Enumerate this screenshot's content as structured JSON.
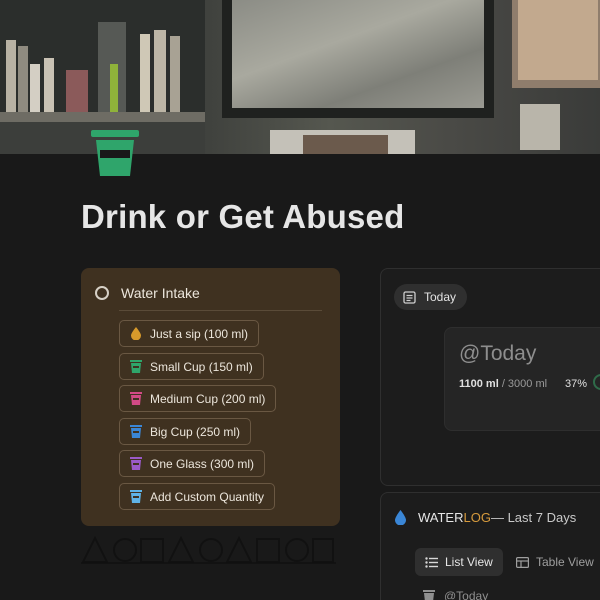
{
  "page": {
    "title": "Drink or Get Abused",
    "icon": "green-cup-icon"
  },
  "intake": {
    "title": "Water Intake",
    "buttons": [
      {
        "label": "Just a sip (100 ml)",
        "icon": "orange-drop-icon",
        "color": "#d89a2b"
      },
      {
        "label": "Small Cup (150 ml)",
        "icon": "green-cup-icon",
        "color": "#2fa56b"
      },
      {
        "label": "Medium Cup (200 ml)",
        "icon": "pink-cup-icon",
        "color": "#d24a86"
      },
      {
        "label": "Big Cup (250 ml)",
        "icon": "blue-cup-icon",
        "color": "#3a86d6"
      },
      {
        "label": "One Glass (300 ml)",
        "icon": "purple-cup-icon",
        "color": "#9a5ac8"
      },
      {
        "label": "Add Custom Quantity",
        "icon": "light-blue-cup-icon",
        "color": "#5fb3e6"
      }
    ]
  },
  "today": {
    "tab_label": "Today",
    "card_title": "@Today",
    "amount": "1100 ml",
    "target": " / 3000 ml",
    "percent": "37%",
    "progress": 0.37
  },
  "log": {
    "title_a": "WATER ",
    "title_b": "LOG",
    "title_c": " — Last 7 Days",
    "views": [
      "List View",
      "Table View"
    ],
    "first_row": "@Today"
  },
  "colors": {
    "accent_green": "#2fa56b",
    "callout_bg": "#3f3120",
    "log_orange": "#d69a3c"
  }
}
